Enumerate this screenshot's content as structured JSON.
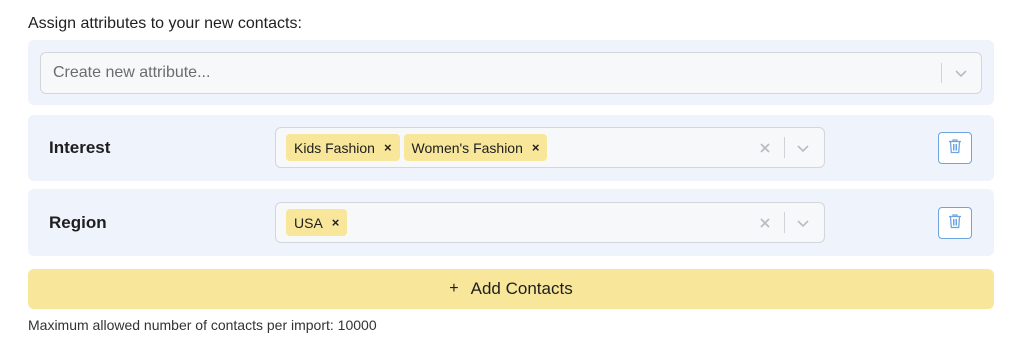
{
  "heading": "Assign attributes to your new contacts:",
  "create_attribute": {
    "placeholder": "Create new attribute..."
  },
  "attributes": [
    {
      "label": "Interest",
      "tags": [
        "Kids Fashion",
        "Women's Fashion"
      ]
    },
    {
      "label": "Region",
      "tags": [
        "USA"
      ]
    }
  ],
  "chip_remove_glyph": "×",
  "add_button": {
    "icon": "+",
    "label": "Add Contacts"
  },
  "footnote": "Maximum allowed number of contacts per import: 10000",
  "colors": {
    "panel_bg": "#eef3fc",
    "chip_bg": "#f8e79a",
    "button_bg": "#f8e79a",
    "trash_border": "#6ea5e0"
  },
  "icons": {
    "dropdown": "chevron-down-icon",
    "clear": "clear-x-icon",
    "delete": "trash-icon"
  }
}
